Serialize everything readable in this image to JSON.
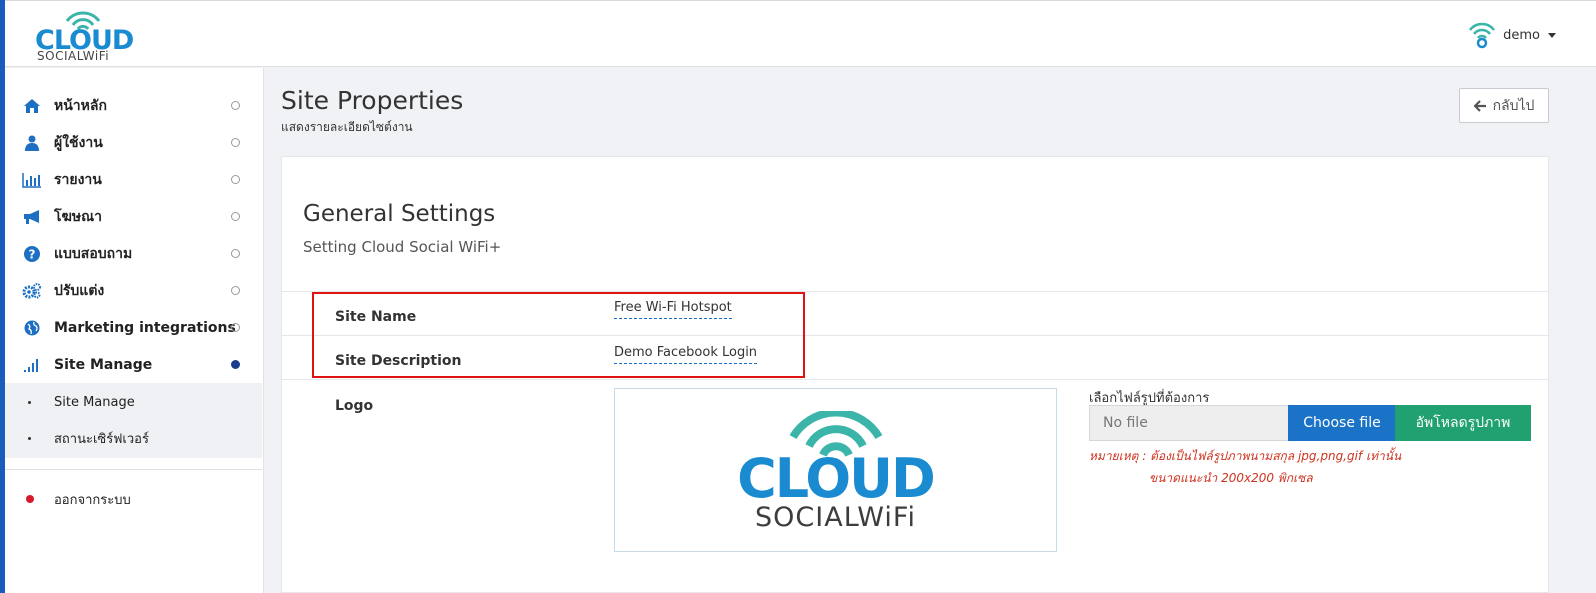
{
  "header": {
    "brand_top": "CLOUD",
    "brand_bottom": "SOCIALWiFi",
    "username": "demo"
  },
  "sidebar": {
    "items": [
      {
        "label": "หน้าหลัก",
        "icon": "home-icon"
      },
      {
        "label": "ผู้ใช้งาน",
        "icon": "user-icon"
      },
      {
        "label": "รายงาน",
        "icon": "bar-chart-icon"
      },
      {
        "label": "โฆษณา",
        "icon": "megaphone-icon"
      },
      {
        "label": "แบบสอบถาม",
        "icon": "question-icon"
      },
      {
        "label": "ปรับแต่ง",
        "icon": "gears-icon"
      },
      {
        "label": "Marketing integrations",
        "icon": "globe-icon"
      },
      {
        "label": "Site Manage",
        "icon": "signal-icon"
      }
    ],
    "sub_items": [
      "Site Manage",
      "สถานะเซิร์ฟเวอร์"
    ],
    "logout": "ออกจากระบบ",
    "active_color": "#1a3c8c"
  },
  "page": {
    "title": "Site Properties",
    "subtitle": "แสดงรายละเอียดไซต์งาน",
    "back_label": "กลับไป"
  },
  "settings": {
    "title": "General Settings",
    "subtitle": "Setting Cloud Social WiFi+",
    "site_name_label": "Site Name",
    "site_name_value": "Free Wi-Fi Hotspot",
    "site_desc_label": "Site Description",
    "site_desc_value": "Demo Facebook Login",
    "logo_label": "Logo",
    "logo_top": "CLOUD",
    "logo_bottom": "SOCIALWiFi"
  },
  "upload": {
    "label": "เลือกไฟล์รูปที่ต้องการ",
    "placeholder": "No file",
    "choose_label": "Choose file",
    "upload_label": "อัพโหลดรูปภาพ",
    "note_line1": "หมายเหตุ : ต้องเป็นไฟล์รูปภาพนามสกุล jpg,png,gif เท่านั้น",
    "note_line2": "ขนาดแนะนำ 200x200 พิกเซล"
  },
  "colors": {
    "brand_blue": "#1b8bd1",
    "wifi_teal": "#3bb5a9",
    "choose_blue": "#1a73c7",
    "upload_green": "#20a16f",
    "highlight_red": "#e01313"
  }
}
